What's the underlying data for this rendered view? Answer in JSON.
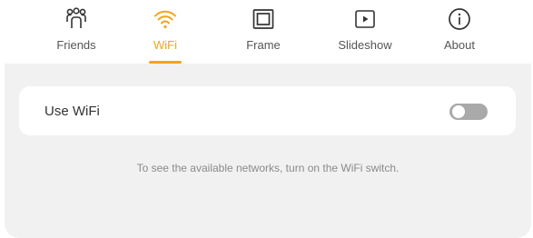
{
  "tabs": [
    {
      "label": "Friends",
      "icon": "friends-icon",
      "active": false
    },
    {
      "label": "WiFi",
      "icon": "wifi-icon",
      "active": true
    },
    {
      "label": "Frame",
      "icon": "frame-icon",
      "active": false
    },
    {
      "label": "Slideshow",
      "icon": "slideshow-icon",
      "active": false
    },
    {
      "label": "About",
      "icon": "info-icon",
      "active": false
    }
  ],
  "wifi": {
    "label": "Use WiFi",
    "enabled": false
  },
  "hint": "To see the available networks, turn on the WiFi switch.",
  "colors": {
    "accent": "#f5a31a",
    "panel_bg": "#f1f1f1",
    "toggle_off": "#a9a9a9"
  }
}
